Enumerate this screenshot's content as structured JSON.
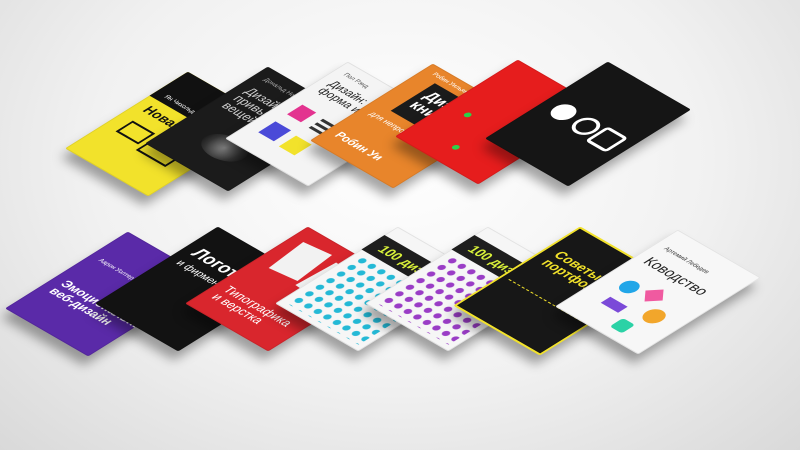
{
  "books": [
    {
      "id": "novaya-tipografika",
      "author": "Ян Чихольд",
      "title": "Новая типо",
      "bg": "#f2e22b",
      "band": "#111111",
      "text": "#111111"
    },
    {
      "id": "dizayn-privychnyh-veshchey",
      "author": "Дональд Норман",
      "title": "Дизайн привычных вещей",
      "bg": "#1b1b1b",
      "text": "#cfcfcf"
    },
    {
      "id": "dizayn-forma-i-haos",
      "author": "Пол Рэнд",
      "title": "Дизайн: форма и хаос",
      "bg": "#f4f4f4",
      "text": "#222222"
    },
    {
      "id": "dizayn-knigi",
      "author": "Робин Уильямс",
      "title": "Дизайн книги",
      "sub": "для непрофессионалов",
      "bg": "#e8852b",
      "band": "#1b1b1b",
      "text": "#ffffff",
      "bottom": "Робин Уи"
    },
    {
      "id": "red-book",
      "bg": "#e61d1d",
      "text": "#ffffff"
    },
    {
      "id": "black-circles",
      "bg": "#151515",
      "text": "#ffffff"
    },
    {
      "id": "veb-dizayn",
      "author": "Аарон Уолтер",
      "title": "Эмоциональный веб-дизайн",
      "badge": "2",
      "bg": "#5a2aa8",
      "text": "#ffffff"
    },
    {
      "id": "logotip",
      "title": "Логотип",
      "sub": "и фирменный стиль",
      "bg": "#121212",
      "text": "#ffffff"
    },
    {
      "id": "tipografika-i-verstka",
      "title": "Типографика и верстка",
      "bg": "#d9262d",
      "text": "#ffffff"
    },
    {
      "id": "100-dizayna-1",
      "title": "100 дизайна",
      "bg": "#f6f6f6",
      "dots": "#24b9d6",
      "band": "#1e1e1e",
      "text": "#d9f23a"
    },
    {
      "id": "100-dizayna-2",
      "title": "100 дизайна",
      "bg": "#f6f6f6",
      "dots": "#9a3dc6",
      "band": "#1e1e1e",
      "text": "#d9f23a"
    },
    {
      "id": "sovety-portfolio",
      "title": "Советы по портфолио",
      "bg": "#171717",
      "text": "#f2e22b"
    },
    {
      "id": "kovodstvo",
      "author": "Артемий Лебедев",
      "title": "Ководство",
      "bg": "#f7f7f7",
      "text": "#222222"
    }
  ]
}
